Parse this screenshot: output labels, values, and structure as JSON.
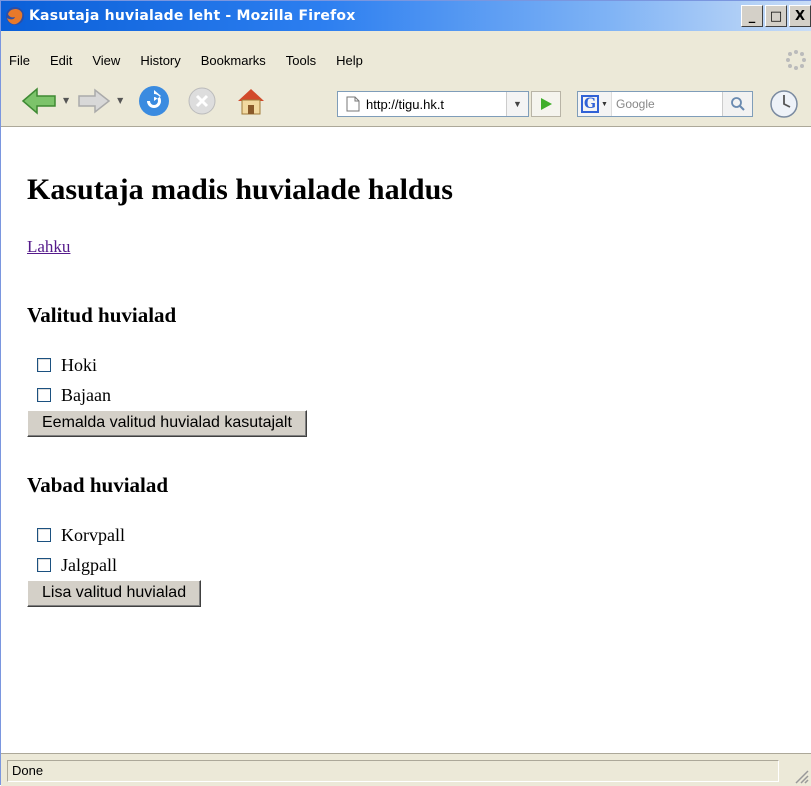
{
  "window": {
    "title": "Kasutaja huvialade leht - Mozilla Firefox",
    "minimize": "_",
    "maximize": "□",
    "close": "X"
  },
  "menu": [
    "File",
    "Edit",
    "View",
    "History",
    "Bookmarks",
    "Tools",
    "Help"
  ],
  "navbar": {
    "url": "http://tigu.hk.t",
    "search_placeholder": "Google"
  },
  "page": {
    "heading": "Kasutaja madis huvialade haldus",
    "logout_link": "Lahku",
    "selected": {
      "heading": "Valitud huvialad",
      "items": [
        "Hoki",
        "Bajaan"
      ],
      "button": "Eemalda valitud huvialad kasutajalt"
    },
    "available": {
      "heading": "Vabad huvialad",
      "items": [
        "Korvpall",
        "Jalgpall"
      ],
      "button": "Lisa valitud huvialad"
    }
  },
  "status": {
    "text": "Done"
  },
  "colors": {
    "titlebar": "#2d7ff0",
    "chrome": "#ece9d8",
    "visited_link": "#551a8b"
  }
}
